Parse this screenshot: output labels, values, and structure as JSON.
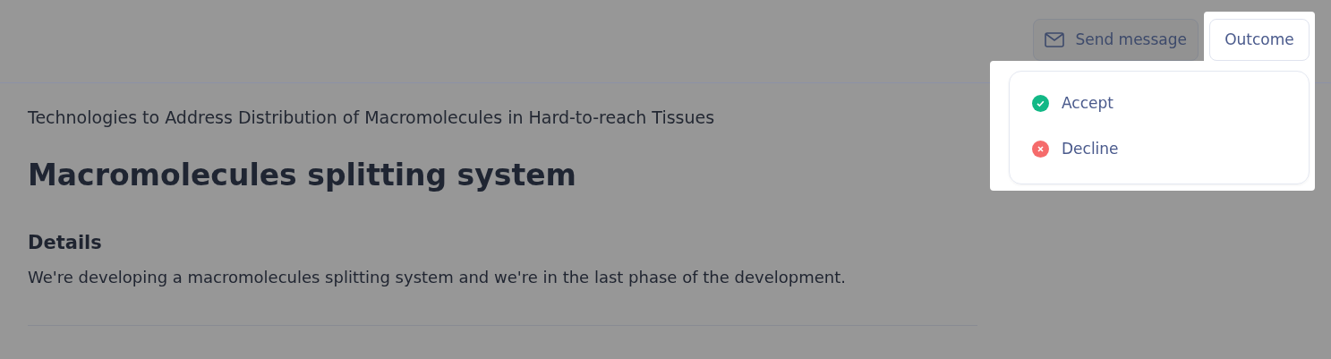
{
  "header": {
    "send_message_button": {
      "label": "Send message"
    },
    "outcome_button": {
      "label": "Outcome"
    }
  },
  "outcome_menu": {
    "open": true,
    "items": [
      {
        "label": "Accept",
        "kind": "accept"
      },
      {
        "label": "Decline",
        "kind": "decline"
      }
    ]
  },
  "program": "Technologies to Address Distribution of Macromolecules in Hard-to-reach Tissues",
  "title": "Macromolecules splitting system",
  "details": {
    "heading": "Details",
    "text": "We're developing a macromolecules splitting system and we're in the last phase of the development."
  }
}
